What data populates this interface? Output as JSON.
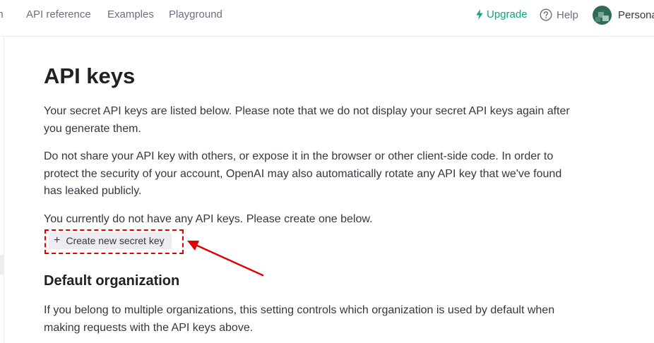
{
  "nav": {
    "docs_fragment": "on",
    "api_reference": "API reference",
    "examples": "Examples",
    "playground": "Playground",
    "upgrade": "Upgrade",
    "help": "Help",
    "account": "Personal"
  },
  "main": {
    "title": "API keys",
    "intro": "Your secret API keys are listed below. Please note that we do not display your secret API keys again after you generate them.",
    "warning": "Do not share your API key with others, or expose it in the browser or other client-side code. In order to protect the security of your account, OpenAI may also automatically rotate any API key that we've found has leaked publicly.",
    "empty_state": "You currently do not have any API keys. Please create one below.",
    "create_button": {
      "icon": "plus-icon",
      "label": "Create new secret key"
    },
    "org_section": {
      "heading": "Default organization",
      "description": "If you belong to multiple organizations, this setting controls which organization is used by default when making requests with the API keys above."
    }
  },
  "annotation": {
    "color": "#e00000"
  },
  "colors": {
    "accent": "#10a37f",
    "text": "#353740",
    "muted": "#6e6e80"
  }
}
